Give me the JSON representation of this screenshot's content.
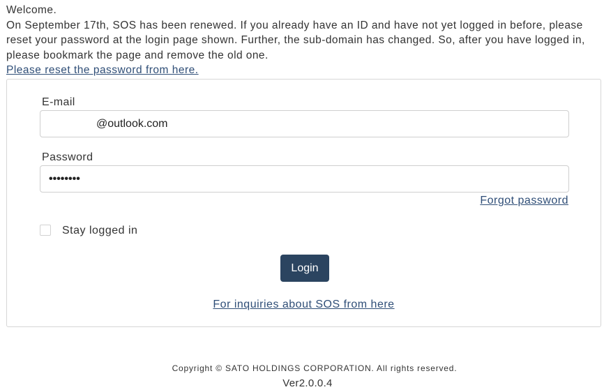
{
  "intro": {
    "welcome": "Welcome.",
    "message": "On September 17th, SOS has been renewed. If you already have an ID and have not yet logged in before, please reset your password at the login page shown. Further, the sub-domain has changed. So, after you have logged in, please bookmark the page and remove the old one.",
    "reset_link": "Please reset the password from here."
  },
  "form": {
    "email_label": "E-mail",
    "email_value": "@outlook.com",
    "password_label": "Password",
    "password_value": "••••••••",
    "forgot_link": "Forgot password",
    "stay_logged_in_label": "Stay logged in",
    "stay_logged_in_checked": false,
    "login_button": "Login",
    "inquiry_link": "For inquiries about SOS from here"
  },
  "footer": {
    "copyright": "Copyright © SATO HOLDINGS CORPORATION. All rights reserved.",
    "version": "Ver2.0.0.4"
  },
  "colors": {
    "link": "#2f4e77",
    "button": "#2b4460",
    "text": "#333333"
  }
}
